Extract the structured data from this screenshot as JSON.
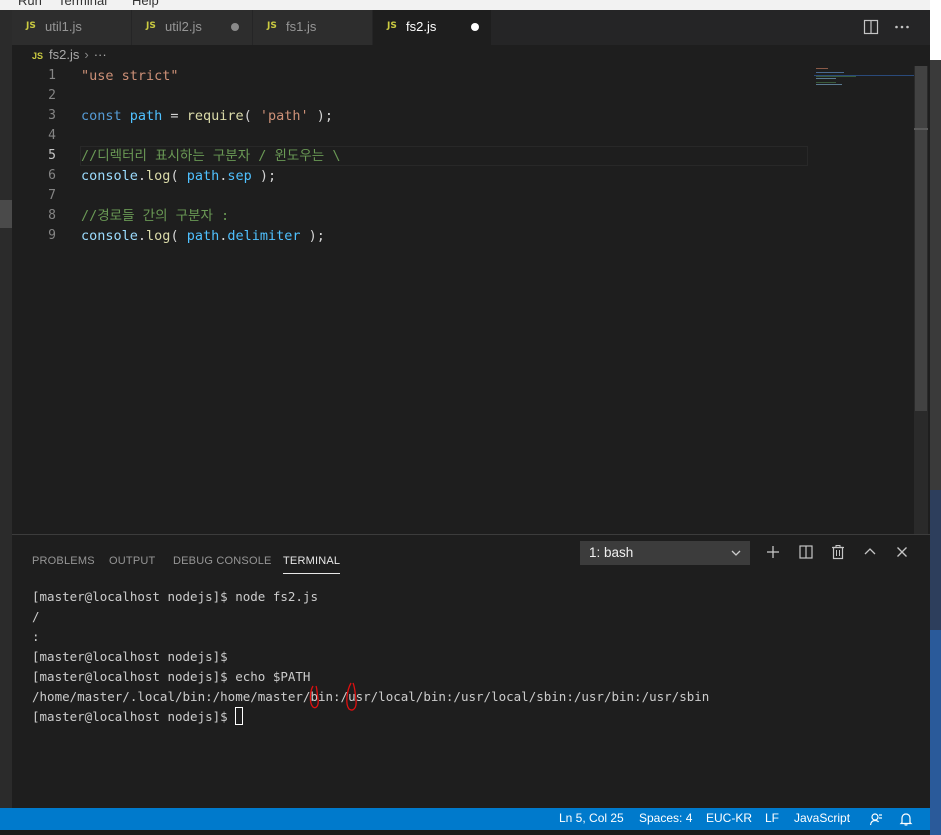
{
  "menubar": {
    "items": [
      "Run",
      "Terminal",
      "Help"
    ]
  },
  "tabs": [
    {
      "lang": "JS",
      "name": "util1.js",
      "modified": false,
      "active": false
    },
    {
      "lang": "JS",
      "name": "util2.js",
      "modified": true,
      "active": false
    },
    {
      "lang": "JS",
      "name": "fs1.js",
      "modified": false,
      "active": false
    },
    {
      "lang": "JS",
      "name": "fs2.js",
      "modified": true,
      "active": true
    }
  ],
  "tab_actions": [
    "split-editor-icon",
    "more-actions-icon"
  ],
  "breadcrumb": {
    "lang": "JS",
    "file": "fs2.js",
    "separator": "›",
    "more": "···"
  },
  "editor": {
    "current_line": 5,
    "lines": [
      {
        "num": "1",
        "tokens": [
          {
            "t": "\"use strict\"",
            "c": "str"
          }
        ]
      },
      {
        "num": "2",
        "tokens": []
      },
      {
        "num": "3",
        "tokens": [
          {
            "t": "const ",
            "c": "kw"
          },
          {
            "t": "path",
            "c": "var"
          },
          {
            "t": " = ",
            "c": "txt"
          },
          {
            "t": "require",
            "c": "fn"
          },
          {
            "t": "( ",
            "c": "txt"
          },
          {
            "t": "'path'",
            "c": "str"
          },
          {
            "t": " );",
            "c": "txt"
          }
        ]
      },
      {
        "num": "4",
        "tokens": []
      },
      {
        "num": "5",
        "tokens": [
          {
            "t": "//디렉터리 표시하는 구분자 / 윈도우는 \\",
            "c": "cmt"
          }
        ]
      },
      {
        "num": "6",
        "tokens": [
          {
            "t": "console",
            "c": "prop"
          },
          {
            "t": ".",
            "c": "txt"
          },
          {
            "t": "log",
            "c": "fn"
          },
          {
            "t": "( ",
            "c": "txt"
          },
          {
            "t": "path",
            "c": "var"
          },
          {
            "t": ".",
            "c": "txt"
          },
          {
            "t": "sep",
            "c": "var"
          },
          {
            "t": " );",
            "c": "txt"
          }
        ]
      },
      {
        "num": "7",
        "tokens": []
      },
      {
        "num": "8",
        "tokens": [
          {
            "t": "//경로들 간의 구분자 :",
            "c": "cmt"
          }
        ]
      },
      {
        "num": "9",
        "tokens": [
          {
            "t": "console",
            "c": "prop"
          },
          {
            "t": ".",
            "c": "txt"
          },
          {
            "t": "log",
            "c": "fn"
          },
          {
            "t": "( ",
            "c": "txt"
          },
          {
            "t": "path",
            "c": "var"
          },
          {
            "t": ".",
            "c": "txt"
          },
          {
            "t": "delimiter",
            "c": "var"
          },
          {
            "t": " );",
            "c": "txt"
          }
        ]
      }
    ]
  },
  "panel": {
    "tabs": [
      {
        "label": "PROBLEMS",
        "active": false
      },
      {
        "label": "OUTPUT",
        "active": false
      },
      {
        "label": "DEBUG CONSOLE",
        "active": false
      },
      {
        "label": "TERMINAL",
        "active": true
      }
    ],
    "terminal_select": "1: bash",
    "actions": [
      "plus-icon",
      "split-terminal-icon",
      "trash-icon",
      "chevron-up-icon",
      "close-icon"
    ]
  },
  "terminal": {
    "lines": [
      "[master@localhost nodejs]$ node fs2.js",
      "/",
      ":",
      "[master@localhost nodejs]$",
      "[master@localhost nodejs]$ echo $PATH",
      "/home/master/.local/bin:/home/master/bin:/usr/local/bin:/usr/local/sbin:/usr/bin:/usr/sbin"
    ],
    "prompt": "[master@localhost nodejs]$ "
  },
  "statusbar": {
    "position": "Ln 5, Col 25",
    "spaces": "Spaces: 4",
    "encoding": "EUC-KR",
    "eol": "LF",
    "language": "JavaScript",
    "icons": [
      "feedback-icon",
      "bell-icon"
    ]
  },
  "colors": {
    "accent": "#007acc",
    "string": "#ce9178",
    "keyword": "#569cd6",
    "variable": "#4fc1ff",
    "function": "#dcdcaa",
    "comment": "#6a9955",
    "annotation": "#e01010"
  }
}
